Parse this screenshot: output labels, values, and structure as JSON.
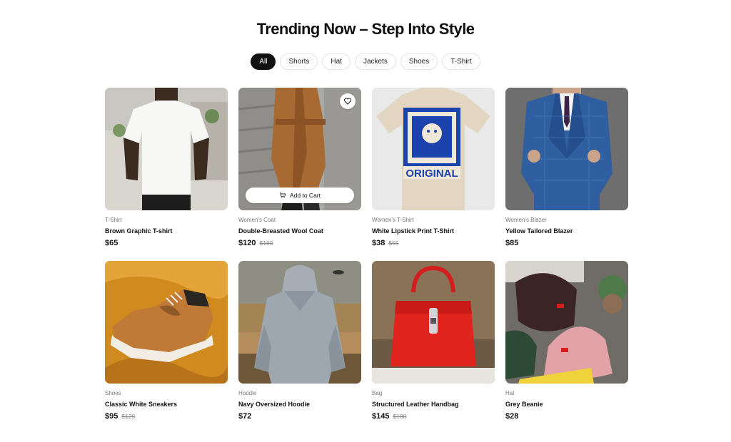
{
  "page": {
    "title": "Trending Now – Step Into Style"
  },
  "filters": [
    {
      "label": "All",
      "active": true
    },
    {
      "label": "Shorts",
      "active": false
    },
    {
      "label": "Hat",
      "active": false
    },
    {
      "label": "Jackets",
      "active": false
    },
    {
      "label": "Shoes",
      "active": false
    },
    {
      "label": "T-Shirt",
      "active": false
    }
  ],
  "actions": {
    "add_to_cart": "Add to Cart"
  },
  "products": [
    {
      "category": "T-Shirt",
      "name": "Brown Graphic T-shirt",
      "price": "$65",
      "old_price": "",
      "image": "white-tshirt-model"
    },
    {
      "category": "Women's Coat",
      "name": "Double-Breasted Wool Coat",
      "price": "$120",
      "old_price": "$160",
      "image": "brown-wool-coat"
    },
    {
      "category": "Women's T-Shirt",
      "name": "White Lipstick Print T-Shirt",
      "price": "$38",
      "old_price": "$55",
      "image": "original-print-tshirt"
    },
    {
      "category": "Women's Blazer",
      "name": "Yellow Tailored Blazer",
      "price": "$85",
      "old_price": "",
      "image": "blue-check-suit"
    },
    {
      "category": "Shoes",
      "name": "Classic White Sneakers",
      "price": "$95",
      "old_price": "$120",
      "image": "tan-sneaker"
    },
    {
      "category": "Hoodie",
      "name": "Navy Oversized Hoodie",
      "price": "$72",
      "old_price": "",
      "image": "grey-hoodie"
    },
    {
      "category": "Bag",
      "name": "Structured Leather Handbag",
      "price": "$145",
      "old_price": "$180",
      "image": "red-handbag"
    },
    {
      "category": "Hat",
      "name": "Grey Beanie",
      "price": "$28",
      "old_price": "",
      "image": "knit-beanies"
    }
  ],
  "colors": {
    "accent": "#111111",
    "muted": "#777777"
  }
}
